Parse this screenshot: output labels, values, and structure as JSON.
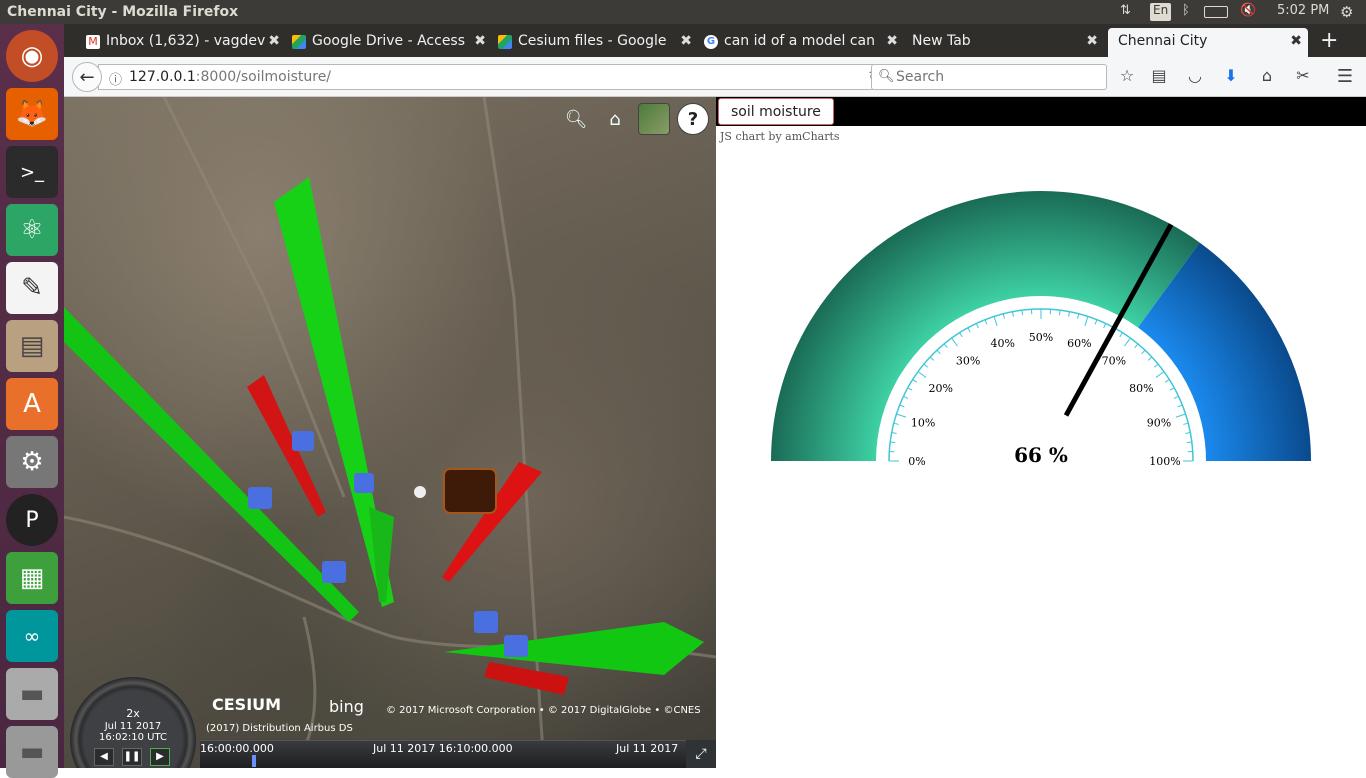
{
  "os": {
    "window_title": "Chennai City - Mozilla Firefox",
    "keyboard_layout": "En",
    "clock": "5:02 PM"
  },
  "tabs": [
    {
      "label": "Inbox (1,632) - vagdev",
      "favicon": "gmail-icon",
      "color": "#d93025"
    },
    {
      "label": "Google Drive - Access",
      "favicon": "google-drive-icon",
      "color": "#1fa463"
    },
    {
      "label": "Cesium files - Google",
      "favicon": "google-drive-icon",
      "color": "#1fa463"
    },
    {
      "label": "can id of a model can",
      "favicon": "google-icon",
      "color": "#4285f4"
    },
    {
      "label": "New Tab",
      "favicon": "",
      "color": ""
    },
    {
      "label": "Chennai City",
      "favicon": "",
      "color": ""
    }
  ],
  "nav": {
    "url_host": "127.0.0.1",
    "url_rest": ":8000/soilmoisture/",
    "search_placeholder": "Search"
  },
  "cesium": {
    "credits": "© 2017 Microsoft Corporation  •  © 2017 DigitalGlobe  •  ©CNES",
    "credits2": "(2017) Distribution Airbus DS",
    "cesium_logo": "CESIUM",
    "bing_logo": "bing",
    "animation": {
      "speed": "2x",
      "date": "Jul 11 2017",
      "time": "16:02:10 UTC"
    },
    "timeline": {
      "label1": "16:00:00.000",
      "label2": "Jul 11 2017 16:10:00.000",
      "label3": "Jul 11 2017"
    }
  },
  "panel": {
    "button_label": "soil moisture",
    "chart_credit": "JS chart by amCharts"
  },
  "chart_data": {
    "type": "gauge",
    "value": 66,
    "value_label": "66 %",
    "min": 0,
    "max": 100,
    "tick_labels": [
      "0%",
      "10%",
      "20%",
      "30%",
      "40%",
      "50%",
      "60%",
      "70%",
      "80%",
      "90%",
      "100%"
    ],
    "bands": [
      {
        "from": 0,
        "to": 70,
        "color": "#1a7a5e"
      },
      {
        "from": 70,
        "to": 100,
        "color": "#0a5bb0"
      }
    ]
  }
}
